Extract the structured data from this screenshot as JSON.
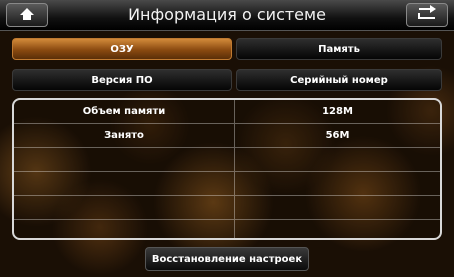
{
  "header": {
    "title": "Информация о системе",
    "home_icon": "home-icon",
    "back_icon": "back-arrow-icon"
  },
  "tabs": [
    {
      "label": "ОЗУ",
      "active": true
    },
    {
      "label": "Память",
      "active": false
    },
    {
      "label": "Версия ПО",
      "active": false
    },
    {
      "label": "Серийный номер",
      "active": false
    }
  ],
  "info_table": {
    "rows": [
      {
        "label": "Объем памяти",
        "value": "128M"
      },
      {
        "label": "Занято",
        "value": "56M"
      },
      {
        "label": "",
        "value": ""
      },
      {
        "label": "",
        "value": ""
      },
      {
        "label": "",
        "value": ""
      },
      {
        "label": "",
        "value": ""
      }
    ]
  },
  "footer": {
    "restore_label": "Восстановление настроек"
  },
  "colors": {
    "accent": "#c07a30",
    "active_tab_top": "#d28a3a",
    "panel_border": "#d8d8d8"
  }
}
